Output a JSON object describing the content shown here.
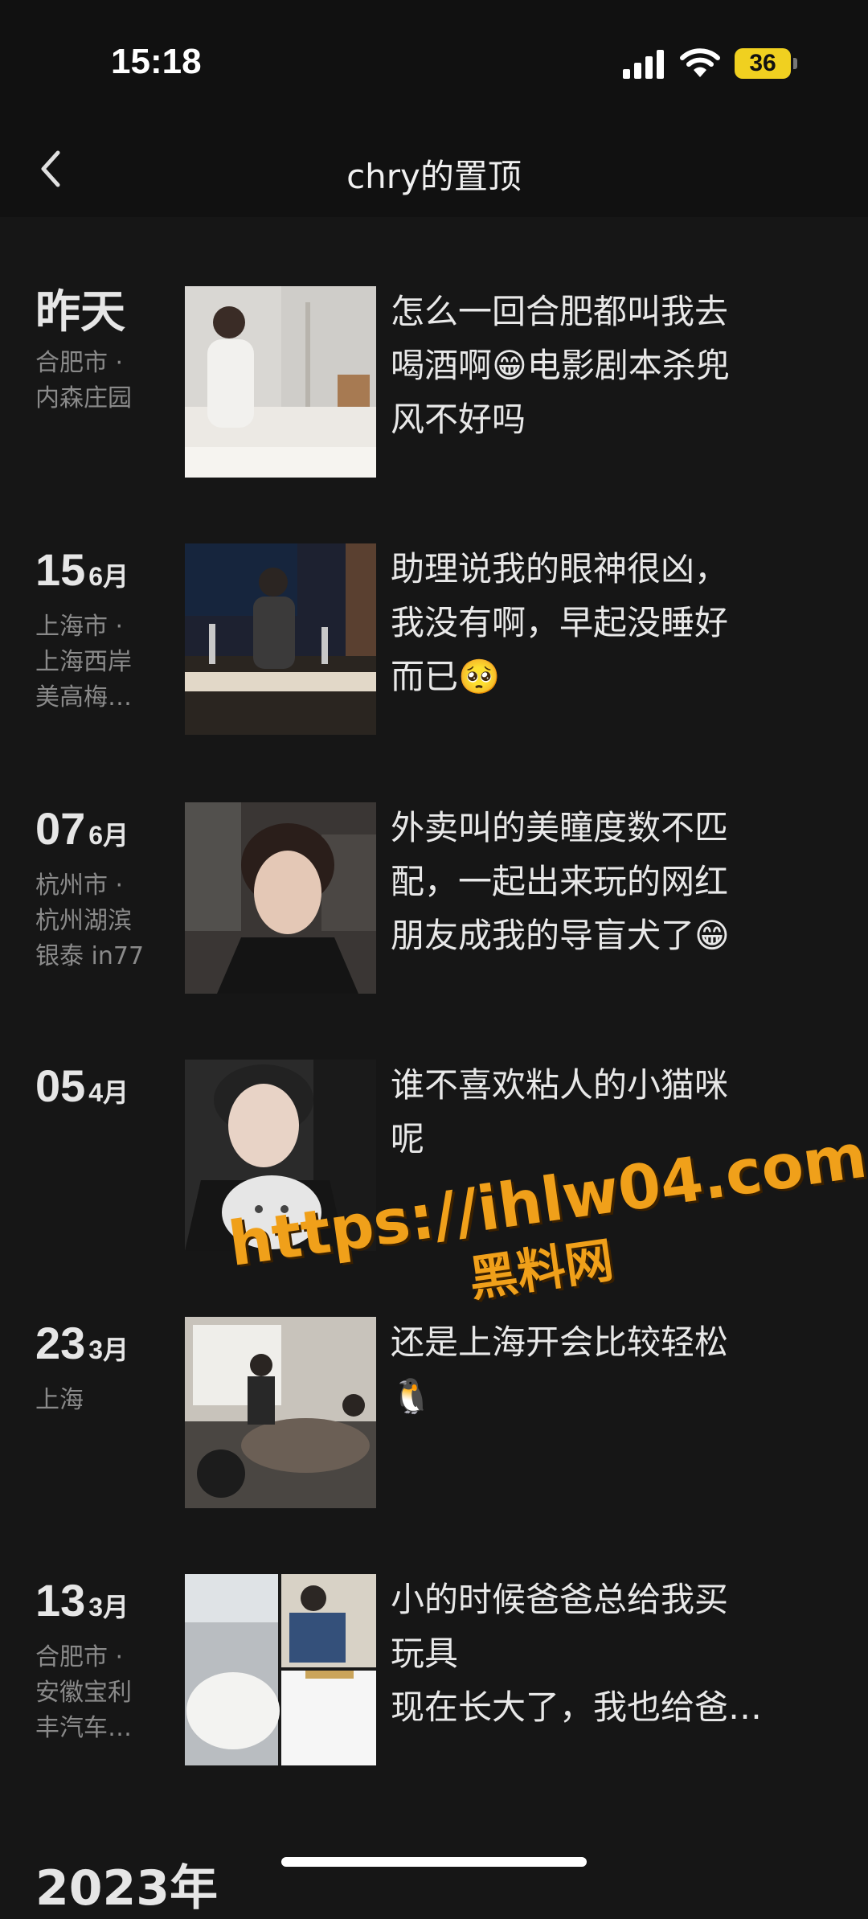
{
  "status": {
    "time": "15:18",
    "battery": "36"
  },
  "header": {
    "title": "chry的置顶"
  },
  "entries": [
    {
      "day": "昨天",
      "month": "",
      "location": "合肥市 ·\n内森庄园",
      "text": "怎么一回合肥都叫我去\n喝酒啊😁电影剧本杀兜\n风不好吗"
    },
    {
      "day": "15",
      "month": "6月",
      "location": "上海市 ·\n上海西岸\n美高梅…",
      "text": "助理说我的眼神很凶，\n我没有啊，早起没睡好\n而已🥺"
    },
    {
      "day": "07",
      "month": "6月",
      "location": "杭州市 ·\n杭州湖滨\n银泰 in77",
      "text": "外卖叫的美瞳度数不匹\n配，一起出来玩的网红\n朋友成我的导盲犬了😁"
    },
    {
      "day": "05",
      "month": "4月",
      "location": "",
      "text": "谁不喜欢粘人的小猫咪\n呢"
    },
    {
      "day": "23",
      "month": "3月",
      "location": "上海",
      "text": "还是上海开会比较轻松\n🐧"
    },
    {
      "day": "13",
      "month": "3月",
      "location": "合肥市 ·\n安徽宝利\n丰汽车…",
      "text": "小的时候爸爸总给我买\n玩具\n现在长大了，我也给爸…"
    }
  ],
  "year_label": "2023年",
  "watermark": {
    "url": "https://ihlw04.com",
    "name": "黑料网"
  }
}
